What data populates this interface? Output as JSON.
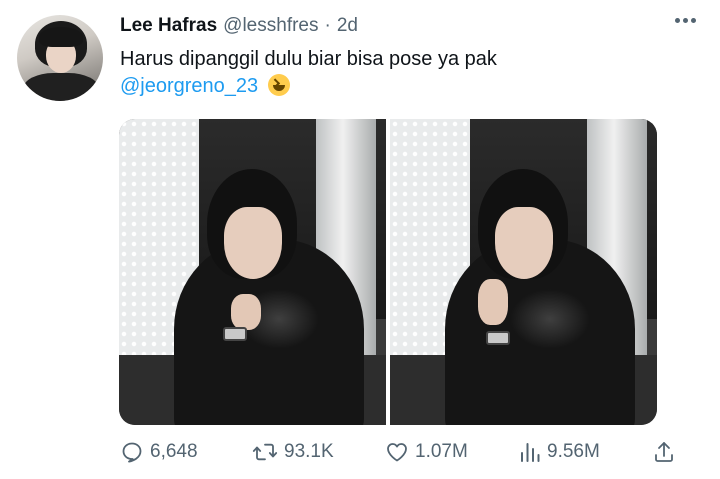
{
  "tweet": {
    "author_name": "Lee Hafras",
    "author_handle": "@lesshfres",
    "separator": "·",
    "time": "2d",
    "text": "Harus dipanggil dulu biar bisa pose ya pak",
    "mention": "@jeorgreno_23",
    "emoji": "laughing-face"
  },
  "media": {
    "count": 2
  },
  "actions": {
    "replies": "6,648",
    "retweets": "93.1K",
    "likes": "1.07M",
    "views": "9.56M"
  },
  "colors": {
    "accent": "#1d9bf0",
    "text": "#0f1419",
    "muted": "#536471"
  }
}
